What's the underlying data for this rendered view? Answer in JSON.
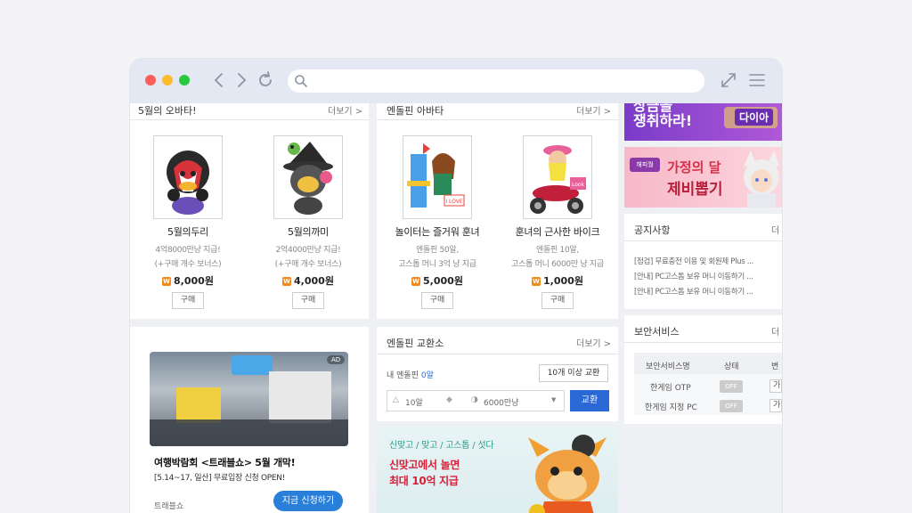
{
  "browser": {
    "url": ""
  },
  "monthly_avatar": {
    "title": "5월의 오바타!",
    "more": "더보기 >",
    "items": [
      {
        "name": "5월의두리",
        "desc1": "4억8000만냥 지급!",
        "desc2": "(+구매 개수 보너스)",
        "price": "8,000원",
        "buy": "구매"
      },
      {
        "name": "5월의까미",
        "desc1": "2억4000만냥 지급!",
        "desc2": "(+구매 개수 보너스)",
        "price": "4,000원",
        "buy": "구매"
      }
    ]
  },
  "endolpin_avatar": {
    "title": "엔돌핀 아바타",
    "more": "더보기 >",
    "items": [
      {
        "name": "놀이터는 즐거워 훈녀",
        "desc1": "엔돌핀 50알,",
        "desc2": "고스톱 머니 3억 냥 지급",
        "price": "5,000원",
        "buy": "구매"
      },
      {
        "name": "훈녀의 근사한 바이크",
        "desc1": "엔돌핀 10알,",
        "desc2": "고스톱 머니 6000만 냥 지급",
        "price": "1,000원",
        "buy": "구매"
      }
    ]
  },
  "ad": {
    "badge": "AD",
    "title": "여행박람회 <트래블쇼> 5월 개막!",
    "desc": "[5.14~17, 일산] 무료입장 신청 OPEN!",
    "advertiser": "트래블쇼",
    "cta": "지금 신청하기"
  },
  "exchange": {
    "title": "엔돌핀 교환소",
    "more": "더보기 >",
    "my_label": "내 엔돌핀",
    "my_value": "0알",
    "bulk_button": "10개 이상 교환",
    "from_value": "10알",
    "to_value": "6000만냥",
    "exchange_button": "교환"
  },
  "promo": {
    "games": "신맞고 / 맞고 / 고스톱 / 섯다",
    "line1": "신맞고에서 놀면",
    "line2": "최대 10억 지급"
  },
  "right_banners": {
    "banner1_text": "상금을\n쟁취하라!",
    "banner1_badge": "다이아",
    "banner2_logo": "해피월",
    "banner2_text1": "가정의 달",
    "banner2_text2": "제비뽑기"
  },
  "notice": {
    "title": "공지사항",
    "more": "더",
    "items": [
      "[점검] 무료충전 이용 및 회원제 Plus ...",
      "[안내] PC고스톱 보유 머니 이동하기 ...",
      "[안내] PC고스톱 보유 머니 이동하기 ..."
    ]
  },
  "security": {
    "title": "보안서비스",
    "more": "더",
    "col_name": "보안서비스명",
    "col_status": "상태",
    "col_change": "변",
    "rows": [
      {
        "name": "한게임 OTP",
        "status": "OFF",
        "action": "가"
      },
      {
        "name": "한게임 지정 PC",
        "status": "OFF",
        "action": "가"
      }
    ]
  }
}
